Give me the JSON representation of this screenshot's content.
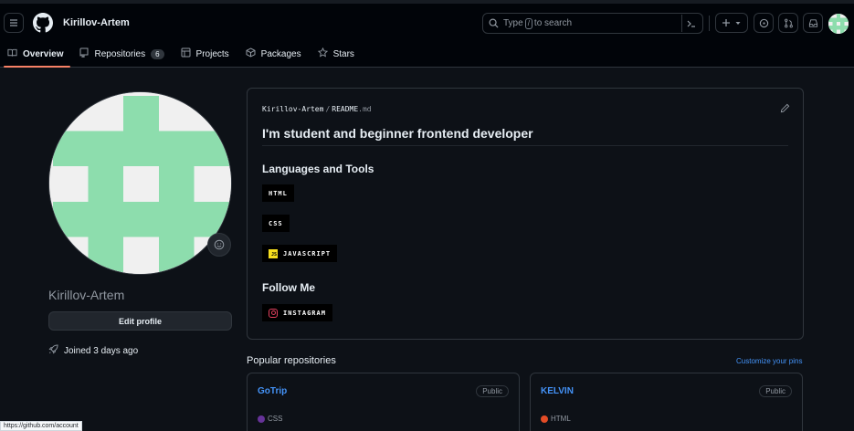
{
  "header": {
    "username": "Kirillov-Artem",
    "search": {
      "prefix": "Type",
      "key": "/",
      "suffix": "to search"
    }
  },
  "tabs": [
    {
      "label": "Overview",
      "icon": "book-icon",
      "selected": true
    },
    {
      "label": "Repositories",
      "icon": "repo-icon",
      "count": "6"
    },
    {
      "label": "Projects",
      "icon": "table-icon"
    },
    {
      "label": "Packages",
      "icon": "package-icon"
    },
    {
      "label": "Stars",
      "icon": "star-icon"
    }
  ],
  "profile": {
    "name": "Kirillov-Artem",
    "edit_label": "Edit profile",
    "joined": "Joined 3 days ago",
    "avatar_colors": {
      "fill": "#8dddad",
      "background": "#f0f0f0"
    }
  },
  "readme": {
    "owner": "Kirillov-Artem",
    "separator": "/",
    "file_base": "README",
    "file_ext": ".md",
    "heading": "I'm student and beginner frontend developer",
    "languages_heading": "Languages and Tools",
    "badges": [
      "HTML",
      "CSS",
      "JAVASCRIPT"
    ],
    "follow_heading": "Follow Me",
    "follow_badge": "INSTAGRAM"
  },
  "popular": {
    "title": "Popular repositories",
    "customize_label": "Customize your pins",
    "repos": [
      {
        "name": "GoTrip",
        "visibility": "Public",
        "language": "CSS",
        "language_color": "#663399"
      },
      {
        "name": "KELVIN",
        "visibility": "Public",
        "language": "HTML",
        "language_color": "#e34c26"
      }
    ]
  },
  "statusbar": {
    "url": "https://github.com/account"
  },
  "colors": {
    "accent": "#f78166",
    "link": "#4493f8",
    "background": "#0d1117"
  }
}
